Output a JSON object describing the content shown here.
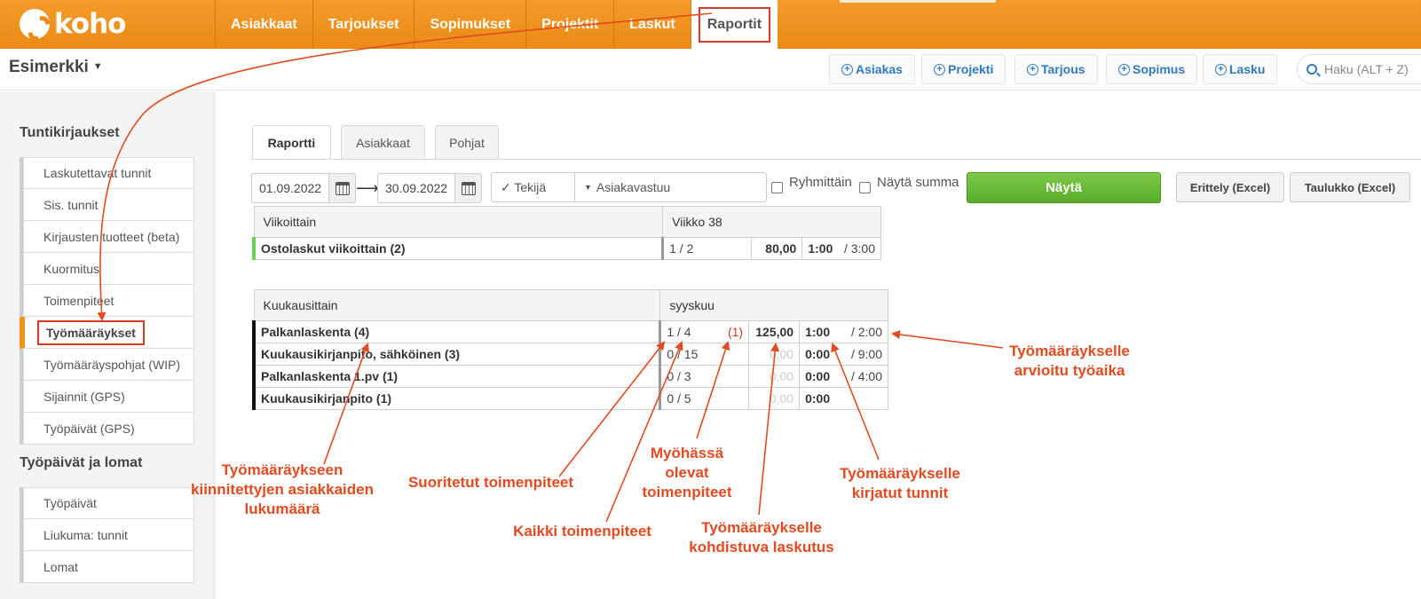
{
  "brand": {
    "name": "koho"
  },
  "nav": [
    "Asiakkaat",
    "Tarjoukset",
    "Sopimukset",
    "Projektit",
    "Laskut",
    "Raportit"
  ],
  "company": "Esimerkki",
  "quick_add": [
    "Asiakas",
    "Projekti",
    "Tarjous",
    "Sopimus",
    "Lasku"
  ],
  "search": {
    "placeholder": "Haku (ALT + Z)"
  },
  "sidebar": {
    "section1_title": "Tuntikirjaukset",
    "section1_items": [
      "Laskutettavat tunnit",
      "Sis. tunnit",
      "Kirjausten tuotteet (beta)",
      "Kuormitus",
      "Toimenpiteet",
      "Työmääräykset",
      "Työmääräyspohjat (WIP)",
      "Sijainnit (GPS)",
      "Työpäivät (GPS)"
    ],
    "section2_title": "Työpäivät ja lomat",
    "section2_items": [
      "Työpäivät",
      "Liukuma: tunnit",
      "Lomat"
    ]
  },
  "tabs": [
    "Raportti",
    "Asiakkaat",
    "Pohjat"
  ],
  "filters": {
    "date_from": "01.09.2022",
    "date_to": "30.09.2022",
    "select_a": "✓ Tekijä",
    "select_b": "Asiakavastuu",
    "check1": "Ryhmittäin",
    "check2": "Näytä summa",
    "show_button": "Näytä",
    "export1": "Erittely (Excel)",
    "export2": "Taulukko (Excel)"
  },
  "weekly": {
    "header": "Viikoittain",
    "period": "Viikko 38",
    "rows": [
      {
        "name": "Ostolaskut viikoittain (2)",
        "done": "1 / 2",
        "late": "",
        "billing": "80,00",
        "hours": "1:00",
        "estimate": "/ 3:00"
      }
    ]
  },
  "monthly": {
    "header": "Kuukausittain",
    "period": "syyskuu",
    "rows": [
      {
        "name": "Palkanlaskenta (4)",
        "done": "1 / 4",
        "late": "(1)",
        "billing": "125,00",
        "hours": "1:00",
        "estimate": "/ 2:00"
      },
      {
        "name": "Kuukausikirjanpito, sähköinen (3)",
        "done": "0 / 15",
        "late": "",
        "billing": "0,00",
        "hours": "0:00",
        "estimate": "/ 9:00"
      },
      {
        "name": "Palkanlaskenta 1.pv (1)",
        "done": "0 / 3",
        "late": "",
        "billing": "0,00",
        "hours": "0:00",
        "estimate": "/ 4:00"
      },
      {
        "name": "Kuukausikirjanpito (1)",
        "done": "0 / 5",
        "late": "",
        "billing": "0,00",
        "hours": "0:00",
        "estimate": ""
      }
    ]
  },
  "annotations": {
    "customers": "Työmääräykseen kiinnitettyjen asiakkaiden lukumäärä",
    "completed": "Suoritetut toimenpiteet",
    "all": "Kaikki toimenpiteet",
    "late": "Myöhässä olevat toimenpiteet",
    "billing": "Työmääräykselle kohdistuva laskutus",
    "hours": "Työmääräykselle kirjatut tunnit",
    "estimate": "Työmääräykselle arvioitu työaika"
  },
  "colors": {
    "brand_orange": "#ec8a16",
    "annotation_red": "#e24a1f",
    "show_green": "#58ad2a",
    "link_blue": "#2f7bbf"
  }
}
